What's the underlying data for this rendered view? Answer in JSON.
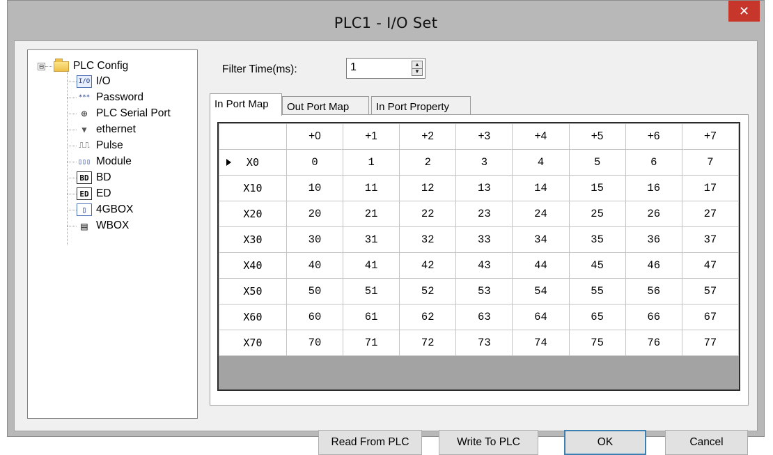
{
  "window": {
    "title": "PLC1 - I/O  Set",
    "close_glyph": "✕"
  },
  "tree": {
    "root": {
      "expander": "⊟",
      "label": "PLC Config",
      "icon": "folder-icon"
    },
    "items": [
      {
        "label": "I/O",
        "icon": "io-icon",
        "icon_text": "I/O",
        "selected": true
      },
      {
        "label": "Password",
        "icon": "password-icon",
        "icon_text": "***"
      },
      {
        "label": "PLC Serial Port",
        "icon": "serial-port-icon",
        "icon_text": "⊕"
      },
      {
        "label": "ethernet",
        "icon": "ethernet-icon",
        "icon_text": "▼"
      },
      {
        "label": "Pulse",
        "icon": "pulse-icon",
        "icon_text": "⎍⎍"
      },
      {
        "label": "Module",
        "icon": "module-icon",
        "icon_text": "▯▯▯"
      },
      {
        "label": "BD",
        "icon": "bd-icon",
        "icon_text": "BD"
      },
      {
        "label": "ED",
        "icon": "ed-icon",
        "icon_text": "ED"
      },
      {
        "label": "4GBOX",
        "icon": "4gbox-icon",
        "icon_text": "▯"
      },
      {
        "label": "WBOX",
        "icon": "wbox-icon",
        "icon_text": "▤"
      }
    ]
  },
  "filter": {
    "label": "Filter Time(ms):",
    "value": "1",
    "up_glyph": "▲",
    "down_glyph": "▼"
  },
  "tabs": [
    {
      "label": "In Port Map",
      "active": true
    },
    {
      "label": "Out Port Map",
      "active": false
    },
    {
      "label": "In Port Property",
      "active": false
    }
  ],
  "table": {
    "columns": [
      "+0",
      "+1",
      "+2",
      "+3",
      "+4",
      "+5",
      "+6",
      "+7"
    ],
    "rows": [
      {
        "label": "X0",
        "current": true,
        "cells": [
          "0",
          "1",
          "2",
          "3",
          "4",
          "5",
          "6",
          "7"
        ]
      },
      {
        "label": "X10",
        "cells": [
          "10",
          "11",
          "12",
          "13",
          "14",
          "15",
          "16",
          "17"
        ]
      },
      {
        "label": "X20",
        "cells": [
          "20",
          "21",
          "22",
          "23",
          "24",
          "25",
          "26",
          "27"
        ]
      },
      {
        "label": "X30",
        "cells": [
          "30",
          "31",
          "32",
          "33",
          "34",
          "35",
          "36",
          "37"
        ]
      },
      {
        "label": "X40",
        "cells": [
          "40",
          "41",
          "42",
          "43",
          "44",
          "45",
          "46",
          "47"
        ]
      },
      {
        "label": "X50",
        "cells": [
          "50",
          "51",
          "52",
          "53",
          "54",
          "55",
          "56",
          "57"
        ]
      },
      {
        "label": "X60",
        "cells": [
          "60",
          "61",
          "62",
          "63",
          "64",
          "65",
          "66",
          "67"
        ]
      },
      {
        "label": "X70",
        "cells": [
          "70",
          "71",
          "72",
          "73",
          "74",
          "75",
          "76",
          "77"
        ]
      }
    ]
  },
  "buttons": {
    "read": "Read From PLC",
    "write": "Write To PLC",
    "ok": "OK",
    "cancel": "Cancel"
  }
}
